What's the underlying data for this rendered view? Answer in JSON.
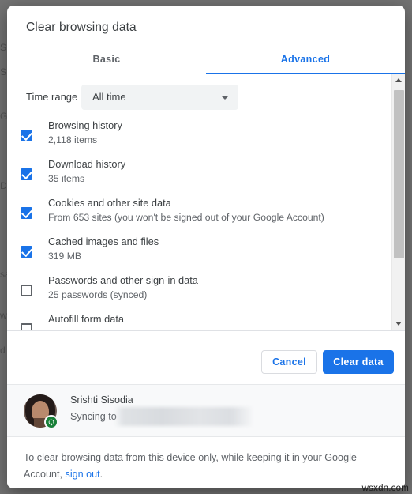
{
  "dialog": {
    "title": "Clear browsing data",
    "tabs": [
      {
        "label": "Basic",
        "active": false
      },
      {
        "label": "Advanced",
        "active": true
      }
    ],
    "time_range": {
      "label": "Time range",
      "selected": "All time"
    },
    "items": [
      {
        "title": "Browsing history",
        "subtitle": "2,118 items",
        "checked": true
      },
      {
        "title": "Download history",
        "subtitle": "35 items",
        "checked": true
      },
      {
        "title": "Cookies and other site data",
        "subtitle": "From 653 sites (you won't be signed out of your Google Account)",
        "checked": true
      },
      {
        "title": "Cached images and files",
        "subtitle": "319 MB",
        "checked": true
      },
      {
        "title": "Passwords and other sign-in data",
        "subtitle": "25 passwords (synced)",
        "checked": false
      },
      {
        "title": "Autofill form data",
        "subtitle": "",
        "checked": false
      }
    ],
    "buttons": {
      "cancel": "Cancel",
      "confirm": "Clear data"
    },
    "account": {
      "name": "Srishti Sisodia",
      "sync_prefix": "Syncing to",
      "sync_target": ""
    },
    "footer": {
      "text_before": "To clear browsing data from this device only, while keeping it in your Google Account, ",
      "link": "sign out",
      "text_after": "."
    }
  },
  "backdrop": {
    "ghosts": [
      "S",
      "S",
      "G",
      "D",
      "sa",
      "wh",
      "d"
    ]
  },
  "watermark": "wsxdn.com",
  "colors": {
    "accent": "#1a73e8",
    "text_primary": "#3c4043",
    "text_secondary": "#5f6368",
    "surface": "#ffffff",
    "strip": "#f8f9fa",
    "sync_green": "#188038"
  }
}
